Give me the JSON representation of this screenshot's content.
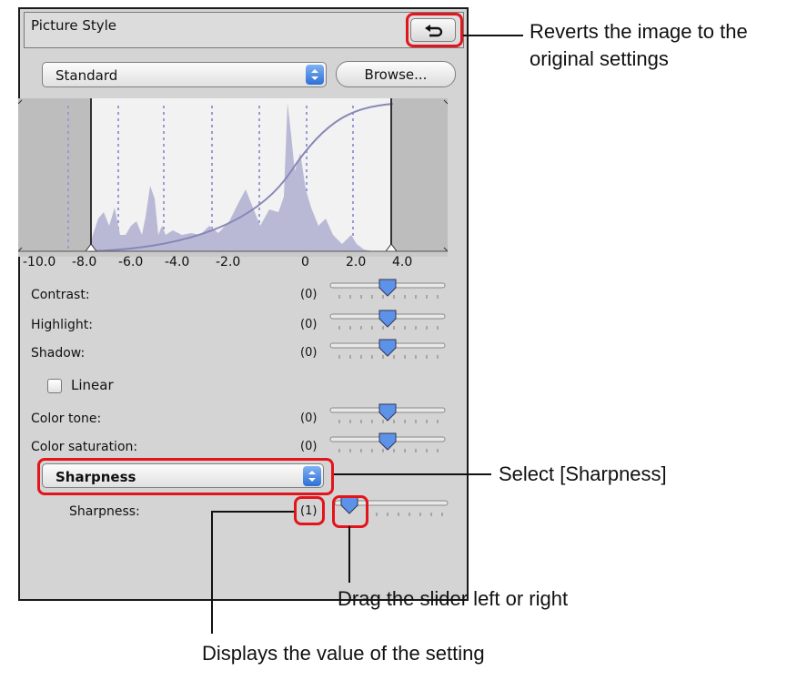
{
  "panel": {
    "title": "Picture Style",
    "revert_icon": "undo-arrow-icon",
    "style_select": "Standard",
    "browse_label": "Browse...",
    "histogram_ticks": [
      "-10.0",
      "-8.0",
      "-6.0",
      "-4.0",
      "-2.0",
      "0",
      "2.0",
      "4.0"
    ],
    "sliders": [
      {
        "label": "Contrast:",
        "value": "(0)"
      },
      {
        "label": "Highlight:",
        "value": "(0)"
      },
      {
        "label": "Shadow:",
        "value": "(0)"
      }
    ],
    "linear_label": "Linear",
    "linear_checked": false,
    "sliders2": [
      {
        "label": "Color tone:",
        "value": "(0)"
      },
      {
        "label": "Color saturation:",
        "value": "(0)"
      }
    ],
    "sharpness_select": "Sharpness",
    "sharpness_label": "Sharpness:",
    "sharpness_value": "(1)"
  },
  "callouts": {
    "revert": "Reverts the image to the original settings",
    "select": "Select [Sharpness]",
    "drag": "Drag the slider left or right",
    "displays": "Displays the value of the setting"
  },
  "colors": {
    "highlight": "#e3141b",
    "histogram_fill": "#b9b9d6",
    "panel_bg": "#d4d4d4"
  }
}
